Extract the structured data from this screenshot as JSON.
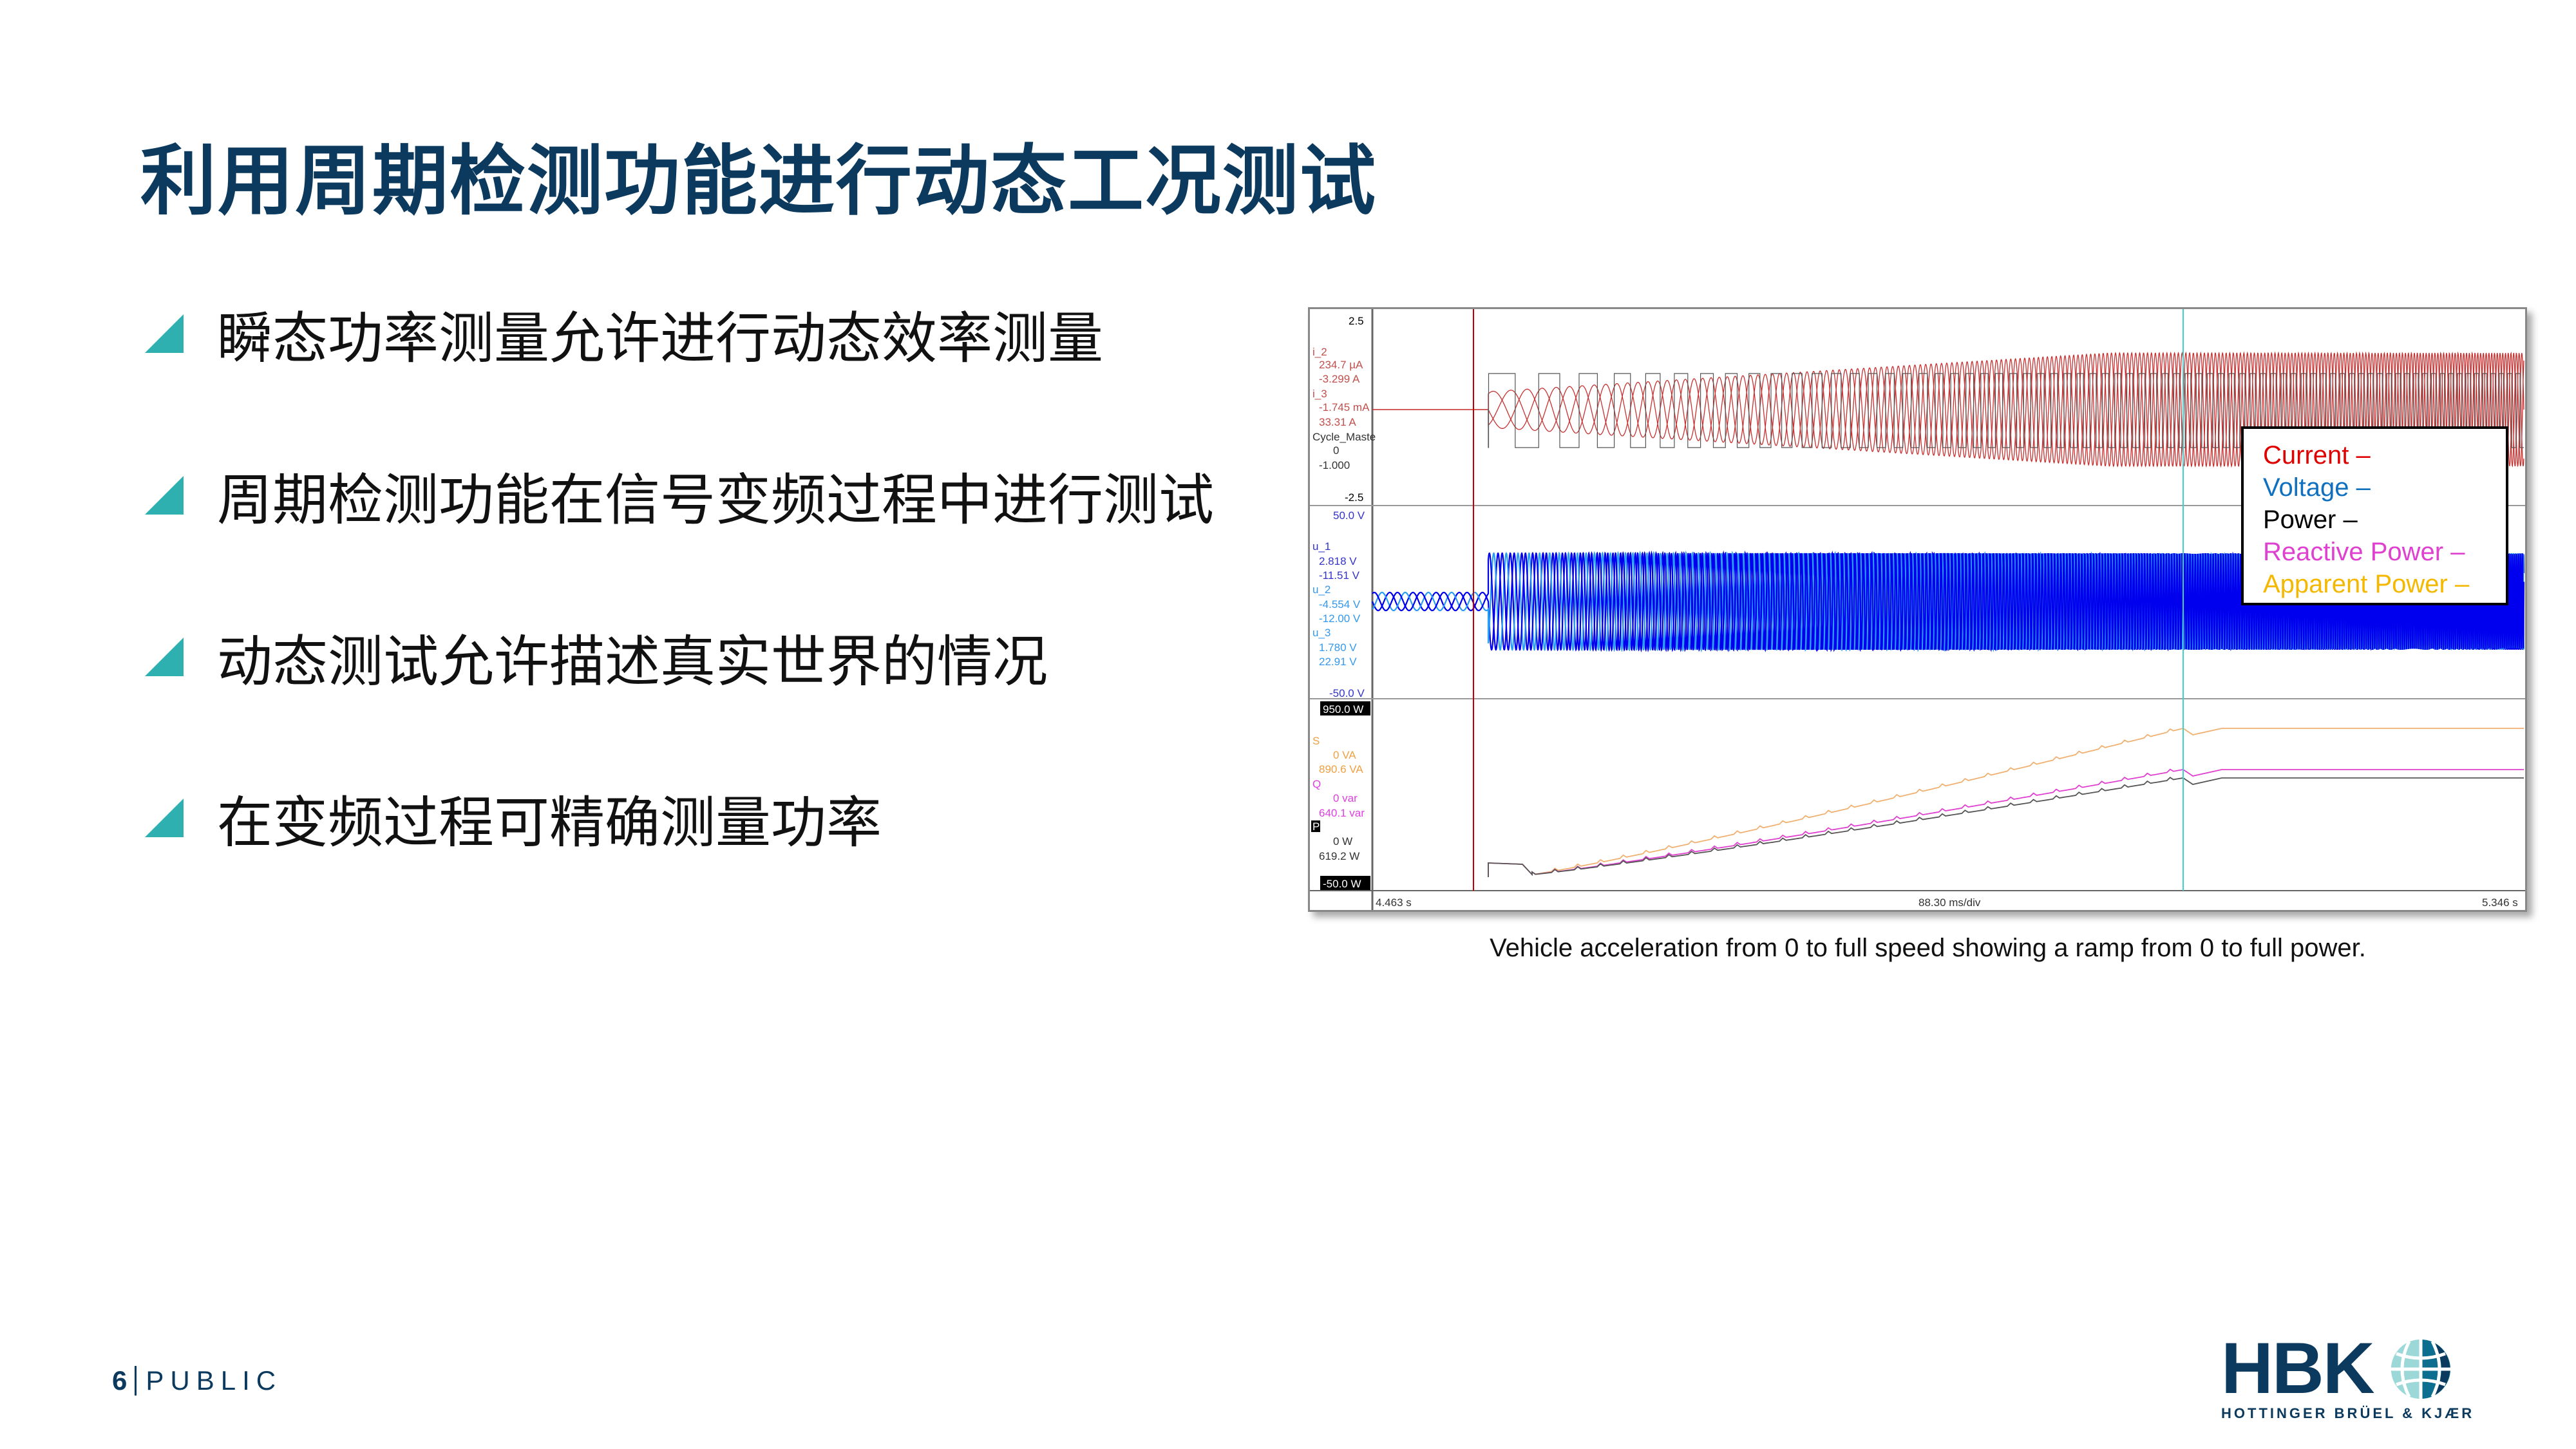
{
  "slide": {
    "title": "利用周期检测功能进行动态工况测试",
    "bullets": [
      "瞬态功率测量允许进行动态效率测量",
      "周期检测功能在信号变频过程中进行测试",
      "动态测试允许描述真实世界的情况",
      "在变频过程可精确测量功率"
    ],
    "bullet_color": "#2fb0b0",
    "caption": "Vehicle acceleration from 0 to full speed showing a ramp from 0 to full power.",
    "page_number": "6",
    "classification": "PUBLIC"
  },
  "chart": {
    "panel1": {
      "top": "2.5",
      "bottom": "-2.5",
      "ch1": {
        "name": "i_2",
        "v1": "234.7 µA",
        "v2": "-3.299  A"
      },
      "ch2": {
        "name": "i_3",
        "v1": "-1.745 mA",
        "v2": "33.31  A"
      },
      "ch3": {
        "name": "Cycle_Maste",
        "v1": "0",
        "v2": "-1.000"
      }
    },
    "panel2": {
      "top": "50.0  V",
      "bottom": "-50.0  V",
      "ch1": {
        "name": "u_1",
        "v1": "2.818  V",
        "v2": "-11.51  V"
      },
      "ch2": {
        "name": "u_2",
        "v1": "-4.554  V",
        "v2": "-12.00  V"
      },
      "ch3": {
        "name": "u_3",
        "v1": "1.780  V",
        "v2": "22.91  V"
      }
    },
    "panel3": {
      "top": "950.0  W",
      "bottom": "-50.0  W",
      "ch1": {
        "name": "S",
        "v1": "0  VA",
        "v2": "890.6  VA"
      },
      "ch2": {
        "name": "Q",
        "v1": "0  var",
        "v2": "640.1  var"
      },
      "ch3": {
        "name": "P",
        "v1": "0  W",
        "v2": "619.2  W"
      }
    },
    "x_start": "4.463 s",
    "x_div": "88.30 ms/div",
    "x_end": "5.346 s",
    "legend": [
      "Current –",
      "Voltage –",
      "Power –",
      "Reactive Power –",
      "Apparent Power –"
    ],
    "colors": {
      "current": "#e00000",
      "voltage": "#1070c0",
      "power": "#000000",
      "reactive": "#e040d0",
      "apparent": "#f5b800",
      "u1": "#0000ee",
      "u2": "#2a9df4"
    }
  },
  "logo": {
    "brand": "HBK",
    "full_name": "HOTTINGER BRÜEL & KJÆR"
  }
}
